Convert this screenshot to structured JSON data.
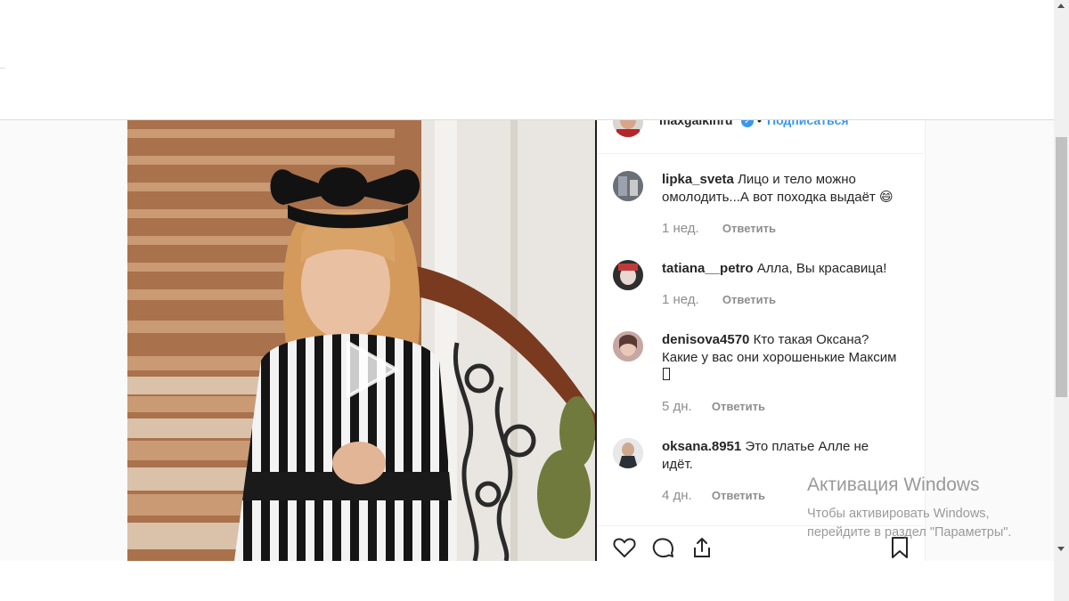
{
  "post": {
    "owner": {
      "username": "maxgalkinru",
      "verified_icon": "verified-check-icon",
      "separator": "•",
      "follow_label": "Подписаться",
      "more_label": "···"
    },
    "comments": [
      {
        "username": "lipka_sveta",
        "text": "Лицо и тело можно омолодить...А вот походка выдаёт 😄",
        "age": "1 нед.",
        "reply_label": "Ответить",
        "avatar_color": "#6b6f78"
      },
      {
        "username": "tatiana__petro",
        "text": "Алла, Вы красавица!",
        "age": "1 нед.",
        "reply_label": "Ответить",
        "avatar_color": "#3a3a3a"
      },
      {
        "username": "denisova4570",
        "text": "Кто такая Оксана? Какие у вас они хорошенькие Максим",
        "age": "5 дн.",
        "reply_label": "Ответить",
        "avatar_color": "#b08d8a"
      },
      {
        "username": "oksana.8951",
        "text": "Это платье Алле не идёт.",
        "age": "4 дн.",
        "reply_label": "Ответить",
        "avatar_color": "#4a4f57"
      }
    ],
    "actions": {
      "like_icon": "heart-icon",
      "comment_icon": "comment-bubble-icon",
      "share_icon": "share-icon",
      "save_icon": "bookmark-icon"
    }
  },
  "video": {
    "play_icon": "play-icon"
  },
  "watermark": {
    "title": "Активация Windows",
    "line1": "Чтобы активировать Windows,",
    "line2": "перейдите в раздел \"Параметры\"."
  },
  "colors": {
    "link": "#3897f0",
    "muted": "#8e8e8e",
    "text": "#262626"
  }
}
